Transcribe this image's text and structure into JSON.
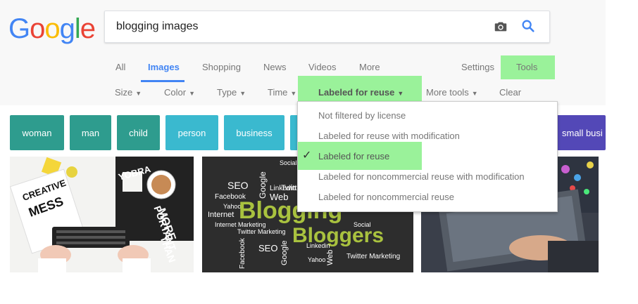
{
  "logo": {
    "letters": [
      "G",
      "o",
      "o",
      "g",
      "l",
      "e"
    ],
    "colors": [
      "#4285f4",
      "#ea4335",
      "#fbbc05",
      "#4285f4",
      "#34a853",
      "#ea4335"
    ]
  },
  "search": {
    "query": "blogging images",
    "camera_icon": "camera-icon",
    "search_icon": "magnifier-icon"
  },
  "nav_tabs": [
    {
      "label": "All"
    },
    {
      "label": "Images",
      "active": true
    },
    {
      "label": "Shopping"
    },
    {
      "label": "News"
    },
    {
      "label": "Videos"
    },
    {
      "label": "More"
    }
  ],
  "settings_label": "Settings",
  "tools_label": "Tools",
  "toolbar": {
    "size": "Size",
    "color": "Color",
    "type": "Type",
    "time": "Time",
    "usage": "Labeled for reuse",
    "more_tools": "More tools",
    "clear": "Clear"
  },
  "chips": [
    "woman",
    "man",
    "child",
    "person",
    "business",
    "small busi"
  ],
  "usage_menu": {
    "items": [
      "Not filtered by license",
      "Labeled for reuse with modification",
      "Labeled for reuse",
      "Labeled for noncommercial reuse with modification",
      "Labeled for noncommercial reuse"
    ],
    "selected_index": 2
  },
  "thumb2_words": {
    "seo": "SEO",
    "facebook": "Facebook",
    "yahoo": "Yahoo",
    "internet": "Internet",
    "internet_marketing": "Internet Marketing",
    "twitter_marketing": "Twitter Marketing",
    "blogging": "Blogging",
    "bloggers": "Bloggers",
    "google": "Google",
    "linkedin": "Linkedin",
    "web": "Web",
    "social": "Social",
    "twitter": "Twitter"
  },
  "thumb1_words": {
    "creative": "CREATIVE",
    "mess": "MESS",
    "more": "MORE",
    "important": "PORTANT",
    "than": "THAN",
    "yobra": "YOBRA"
  },
  "colors": {
    "accent": "#4285f4",
    "highlight": "#9af29a",
    "teal": "#2e9c8e",
    "cyan": "#3ab9cf",
    "purple": "#5348b7"
  }
}
